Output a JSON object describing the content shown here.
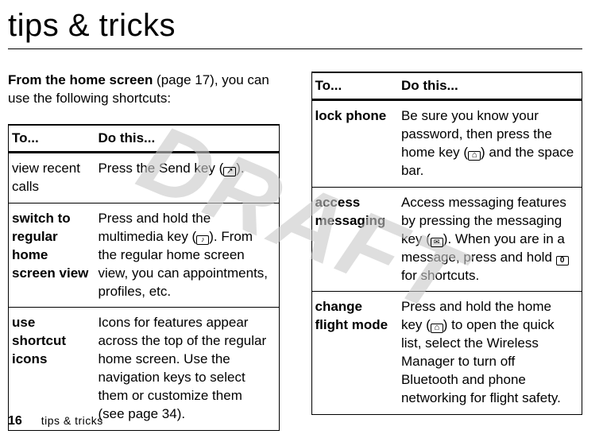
{
  "watermark": "DRAFT",
  "page_title": "tips & tricks",
  "intro": {
    "bold": "From the home screen",
    "rest": " (page 17), you can use the following shortcuts:"
  },
  "headers": {
    "col1": "To...",
    "col2": "Do this..."
  },
  "left_rows": [
    {
      "to": "view recent calls",
      "to_bold": false,
      "d1": "Press the Send key (",
      "icon": "send",
      "d2": ")."
    },
    {
      "to": "switch to regular home screen view",
      "to_bold": true,
      "d1": "Press and hold the multimedia key (",
      "icon": "mm",
      "d2": "). From the regular home screen view, you can appointments, profiles, etc."
    },
    {
      "to": "use shortcut icons",
      "to_bold": true,
      "d1": "Icons for features appear across the top of the regular home screen. Use the navigation keys to select them or customize them (see page 34).",
      "icon": "",
      "d2": ""
    }
  ],
  "right_rows": [
    {
      "to": "lock phone",
      "to_bold": true,
      "d1": "Be sure you know your password, then press the home key (",
      "icon": "home",
      "d2": ") and the space bar."
    },
    {
      "to": "access messaging",
      "to_bold": true,
      "d1": "Access messaging features by pressing the messaging key (",
      "icon": "msg",
      "d2": "). When you are in a message, press and hold ",
      "icon2": "zero",
      "d3": " for shortcuts."
    },
    {
      "to": "change flight mode",
      "to_bold": true,
      "d1": "Press and hold the home key (",
      "icon": "home",
      "d2": ") to open the quick list, select the Wireless Manager to turn off Bluetooth and phone networking for flight safety."
    }
  ],
  "footer": {
    "page": "16",
    "section": "tips & tricks"
  }
}
